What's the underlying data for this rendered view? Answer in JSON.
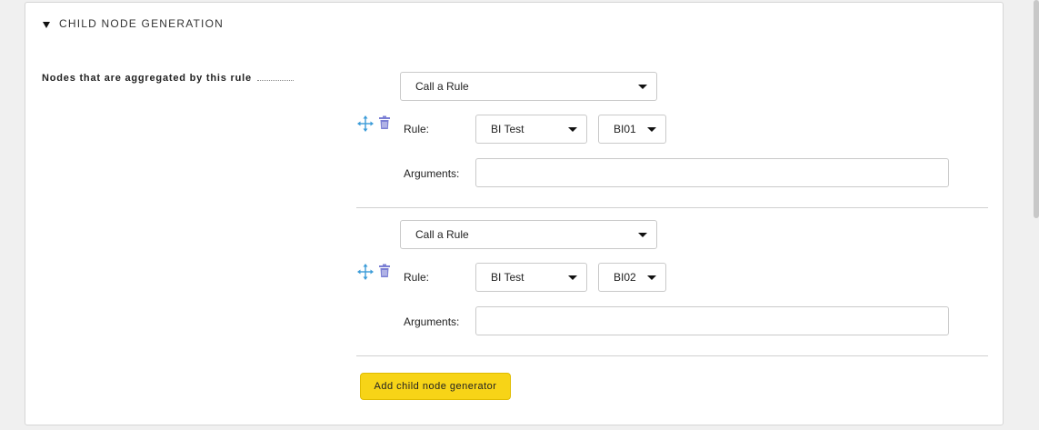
{
  "section": {
    "title": "CHILD NODE GENERATION",
    "field_label": "Nodes that are aggregated by this rule"
  },
  "generators": [
    {
      "type_select": "Call a Rule",
      "rule_label": "Rule:",
      "rule_select": "BI Test",
      "rule_id_select": "BI01",
      "arguments_label": "Arguments:",
      "arguments_value": ""
    },
    {
      "type_select": "Call a Rule",
      "rule_label": "Rule:",
      "rule_select": "BI Test",
      "rule_id_select": "BI02",
      "arguments_label": "Arguments:",
      "arguments_value": ""
    }
  ],
  "icons": {
    "move": "move-arrows-icon",
    "delete": "trash-icon"
  },
  "add_button_label": "Add child node generator",
  "colors": {
    "move_icon": "#3a9bd8",
    "trash_icon": "#7b7fd4",
    "add_button": "#f7d417"
  }
}
